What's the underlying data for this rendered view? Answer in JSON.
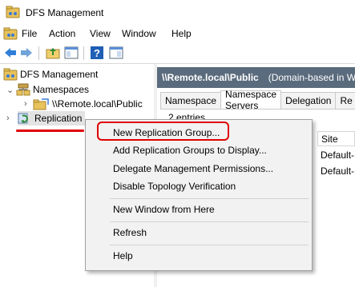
{
  "window": {
    "title": "DFS Management"
  },
  "menubar": {
    "items": [
      "File",
      "Action",
      "View",
      "Window",
      "Help"
    ]
  },
  "toolbar": {
    "buttons": [
      "back-icon",
      "forward-icon",
      "up-folder-icon",
      "show-hide-console-tree-icon",
      "help-icon",
      "action-pane-icon"
    ]
  },
  "tree": {
    "root": "DFS Management",
    "namespaces": "Namespaces",
    "namespace_child": "\\\\Remote.local\\Public",
    "replication": "Replication"
  },
  "right_pane": {
    "header_path": "\\\\Remote.local\\Public",
    "header_desc": "(Domain-based in W",
    "tabs": [
      "Namespace",
      "Namespace Servers",
      "Delegation",
      "Re"
    ],
    "active_tab": "Namespace Servers",
    "entries": "2 entries",
    "column_site": "Site",
    "rows": [
      "Default-F",
      "Default-F"
    ]
  },
  "context_menu": {
    "items": [
      "New Replication Group...",
      "Add Replication Groups to Display...",
      "Delegate Management Permissions...",
      "Disable Topology Verification",
      "New Window from Here",
      "Refresh",
      "Help"
    ]
  },
  "colors": {
    "annotation_red": "#e00000",
    "header_bg": "#5a6b7d"
  }
}
